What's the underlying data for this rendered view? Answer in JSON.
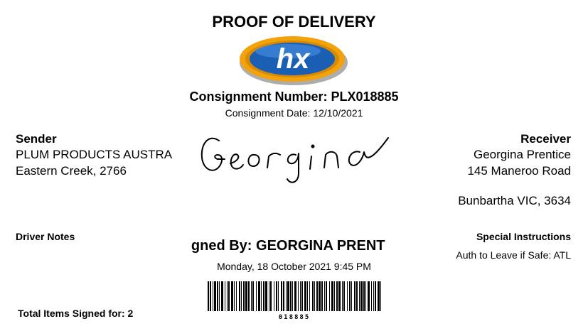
{
  "title": "PROOF OF DELIVERY",
  "logo": {
    "text": "hx",
    "colors": {
      "outer": "#f2a20b",
      "inner": "#1a5fb4",
      "text": "#ffffff"
    }
  },
  "consignment": {
    "number": "Consignment Number: PLX018885",
    "date": "Consignment Date: 12/10/2021"
  },
  "sender": {
    "heading": "Sender",
    "line1": "PLUM PRODUCTS AUSTRA",
    "line2": "Eastern Creek, 2766"
  },
  "receiver": {
    "heading": "Receiver",
    "line1": "Georgina Prentice",
    "line2": "145 Maneroo Road",
    "line3": "Bunbartha VIC, 3634"
  },
  "signature": {
    "text": "Georgina"
  },
  "driver_notes": {
    "heading": "Driver Notes"
  },
  "special_instructions": {
    "heading": "Special Instructions",
    "value": "Auth to Leave if Safe: ATL"
  },
  "signed": {
    "by": "Signed By: GEORGINA PRENT",
    "datetime": "Monday, 18 October 2021 9:45 PM"
  },
  "barcode": {
    "value": "018885"
  },
  "total_items": "Total Items Signed for: 2"
}
